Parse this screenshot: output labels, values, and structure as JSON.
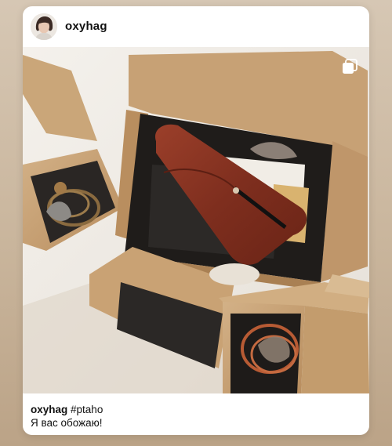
{
  "post": {
    "username": "oxyhag",
    "avatar_icon": "user-avatar",
    "media_type_icon": "multiple-photos-icon",
    "image_alt": "",
    "caption": {
      "username": "oxyhag",
      "hashtag": "#ptaho",
      "text": "Я вас обожаю!"
    }
  },
  "colors": {
    "card_background": "#ffffff",
    "page_background": "#c9b59c",
    "cardboard": "#c9a57a",
    "leather": "#8a3524",
    "text": "#111111"
  }
}
